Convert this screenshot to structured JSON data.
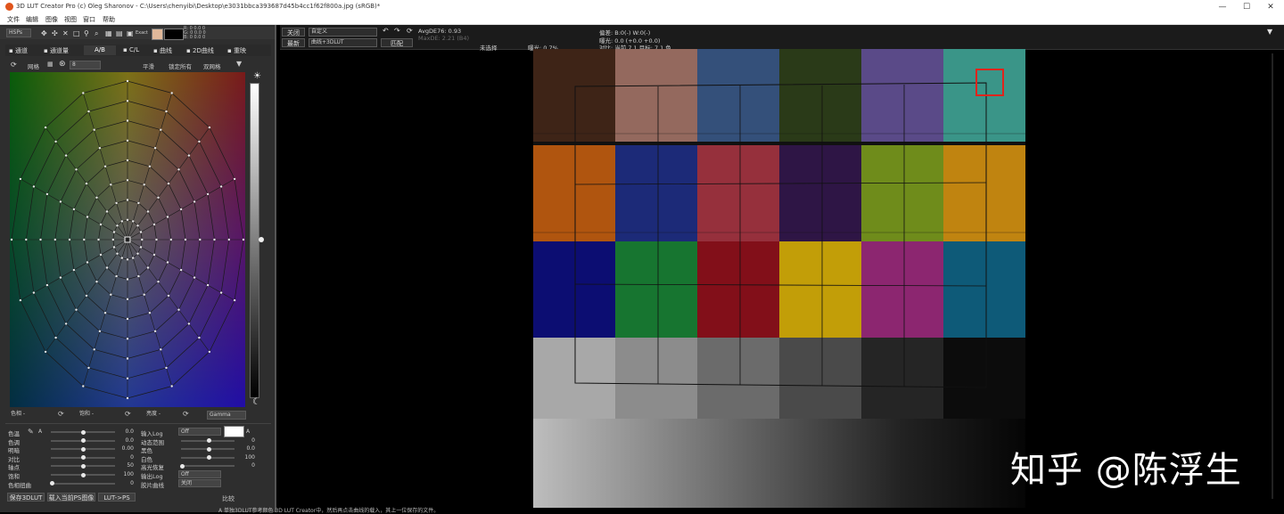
{
  "window": {
    "title": "3D LUT Creator Pro (c) Oleg Sharonov - C:\\Users\\chenyibi\\Desktop\\e3031bbca393687d45b4cc1f62f800a.jpg (sRGB)*",
    "minimize": "—",
    "maximize": "☐",
    "close": "✕"
  },
  "menu": [
    "文件",
    "编辑",
    "图像",
    "视图",
    "窗口",
    "帮助"
  ],
  "left_toolbar": {
    "mode": "HSPs",
    "exact_label": "Exact",
    "readout_r": "R:  0   0.0  0",
    "readout_g": "G:  0   0.0  0",
    "readout_b": "B:  0   0.0  0"
  },
  "left_tabs": [
    {
      "label": "通道"
    },
    {
      "label": "通道量"
    },
    {
      "label": "A/B"
    },
    {
      "label": "C/L"
    },
    {
      "label": "曲线"
    },
    {
      "label": "2D曲线"
    },
    {
      "label": "重映"
    }
  ],
  "grid_controls": {
    "grid_label": "网格",
    "grid_count": "8",
    "smooth": "平滑",
    "lock_all": "锁定所有",
    "double_grid": "双网格"
  },
  "wheel_footer": {
    "hue_dropdown": "色相 -",
    "sat_dropdown": "饱和 -",
    "lum_dropdown": "亮度 -",
    "gamma_dropdown": "Gamma"
  },
  "adjust_left": [
    {
      "label": "色温",
      "value": "0.0",
      "pos": 0.5
    },
    {
      "label": "色调",
      "value": "0.0",
      "pos": 0.5
    },
    {
      "label": "明暗",
      "value": "0.00",
      "pos": 0.5
    },
    {
      "label": "对比",
      "value": "0",
      "pos": 0.5
    },
    {
      "label": "轴点",
      "value": "50",
      "pos": 0.5
    },
    {
      "label": "饱和",
      "value": "100",
      "pos": 0.5
    },
    {
      "label": "色相扭曲",
      "value": "0",
      "pos": 0.02
    }
  ],
  "adjust_right": [
    {
      "label": "输入Log",
      "value": "Off",
      "kind": "dropdown"
    },
    {
      "label": "动态范围",
      "value": "0",
      "pos": 0.85
    },
    {
      "label": "黑色",
      "value": "0.0",
      "pos": 0.85
    },
    {
      "label": "白色",
      "value": "100",
      "pos": 0.85
    },
    {
      "label": "高光恢复",
      "value": "0",
      "pos": 0.02
    },
    {
      "label": "输出Log",
      "value": "Off",
      "kind": "dropdown"
    },
    {
      "label": "胶片曲线",
      "value": "关闭",
      "kind": "dropdown"
    }
  ],
  "bottom_buttons": {
    "save_lut": "保存3DLUT",
    "load_ps": "载入当前PS图像",
    "lut_ps": "LUT->PS",
    "compare": "比较"
  },
  "top_toolbar": {
    "close": "关闭",
    "preset": "自定义",
    "latest": "最新",
    "curve_mode": "曲线+3DLUT",
    "match": "匹配",
    "avg_de": "AvgDE76: 0.93",
    "max_de": "MaxDE: 2.21 (B4)",
    "unselected": "未选择",
    "exposure_pct": "曝光: 0.7%",
    "balance": "偏差: B:0(-) W:0(-)",
    "exposure": "曝光: 0.0 (+0.0 +0.0)",
    "contrast": "对比: 当前 7.1 目标: 7.1 色"
  },
  "watermark": "知乎 @陈浮生",
  "caption": "A 单独3DLUT参考颜色 3D LUT Creator中，然后再点击曲线的载入，其上一位保存的文件。",
  "colors": {
    "patches_row1": [
      "#3e2417",
      "#94695e",
      "#34507a",
      "#2a3a18",
      "#5a4a88",
      "#3a9588"
    ],
    "patches_row2": [
      "#b0550f",
      "#1c2a78",
      "#96303c",
      "#2e1545",
      "#6f8c1b",
      "#c08410"
    ],
    "patches_row3": [
      "#0c0d72",
      "#177530",
      "#820f19",
      "#c29e08",
      "#8c2670",
      "#0e5a78"
    ],
    "patches_row4": [
      "#a8a8a8",
      "#8c8c8c",
      "#6b6b6b",
      "#4a4a4a",
      "#252525",
      "#0c0c0c"
    ],
    "accent_red": "#e0241c"
  }
}
